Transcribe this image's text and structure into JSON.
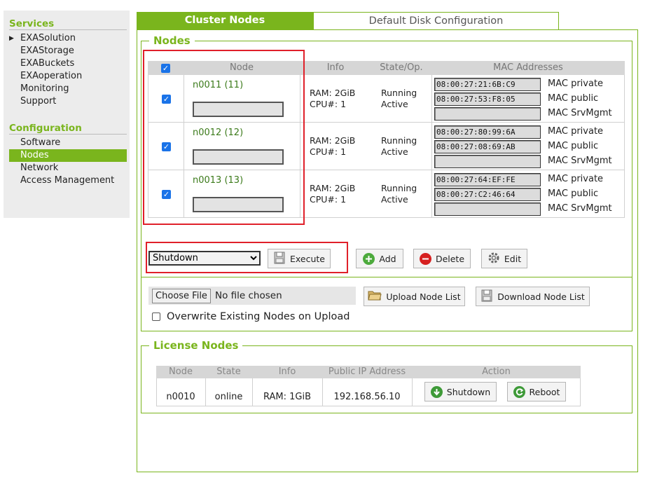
{
  "sidebar": {
    "services_heading": "Services",
    "services": [
      "EXASolution",
      "EXAStorage",
      "EXABuckets",
      "EXAoperation",
      "Monitoring",
      "Support"
    ],
    "config_heading": "Configuration",
    "config": [
      "Software",
      "Nodes",
      "Network",
      "Access Management"
    ],
    "active": "Nodes"
  },
  "tabs": {
    "cluster_nodes": "Cluster Nodes",
    "default_disk": "Default Disk Configuration"
  },
  "nodes_section": {
    "legend": "Nodes",
    "columns": [
      "Node",
      "Info",
      "State/Op.",
      "MAC Addresses"
    ],
    "rows": [
      {
        "name": "n0011 (11)",
        "ram": "RAM: 2GiB",
        "cpu": "CPU#: 1",
        "state": "Running",
        "op": "Active",
        "mac_private": "08:00:27:21:6B:C9",
        "mac_public": "08:00:27:53:F8:05",
        "mac_srvmgmt": ""
      },
      {
        "name": "n0012 (12)",
        "ram": "RAM: 2GiB",
        "cpu": "CPU#: 1",
        "state": "Running",
        "op": "Active",
        "mac_private": "08:00:27:80:99:6A",
        "mac_public": "08:00:27:08:69:AB",
        "mac_srvmgmt": ""
      },
      {
        "name": "n0013 (13)",
        "ram": "RAM: 2GiB",
        "cpu": "CPU#: 1",
        "state": "Running",
        "op": "Active",
        "mac_private": "08:00:27:64:EF:FE",
        "mac_public": "08:00:27:C2:46:64",
        "mac_srvmgmt": ""
      }
    ],
    "mac_labels": {
      "private": "MAC private",
      "public": "MAC public",
      "srvmgmt": "MAC SrvMgmt"
    },
    "action_select": "Shutdown",
    "execute_label": "Execute",
    "add_label": "Add",
    "delete_label": "Delete",
    "edit_label": "Edit",
    "choose_file_label": "Choose File",
    "no_file_text": "No file chosen",
    "upload_label": "Upload Node List",
    "download_label": "Download Node List",
    "overwrite_label": "Overwrite Existing Nodes on Upload"
  },
  "license_section": {
    "legend": "License Nodes",
    "columns": [
      "Node",
      "State",
      "Info",
      "Public IP Address",
      "Action"
    ],
    "row": {
      "node": "n0010",
      "state": "online",
      "info": "RAM: 1GiB",
      "ip": "192.168.56.10"
    },
    "shutdown_label": "Shutdown",
    "reboot_label": "Reboot"
  },
  "colors": {
    "accent": "#7ab51d",
    "highlight": "#e0202a",
    "checkbox": "#1a73e8"
  }
}
